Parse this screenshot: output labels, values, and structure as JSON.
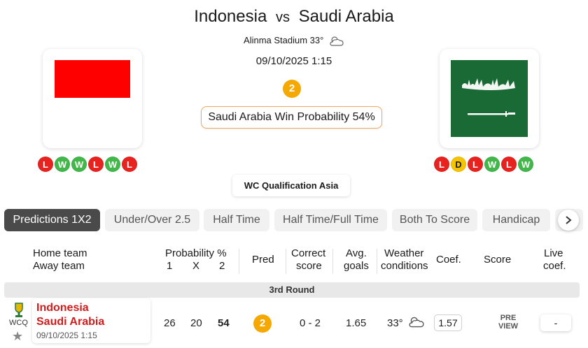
{
  "match": {
    "home": "Indonesia",
    "vs": "vs",
    "away": "Saudi Arabia",
    "venue": "Alinma Stadium 33°",
    "datetime": "09/10/2025 1:15",
    "prediction": "2",
    "win_probability": "Saudi Arabia Win Probability 54%",
    "competition": "WC Qualification Asia"
  },
  "form": {
    "home": [
      "L",
      "W",
      "W",
      "L",
      "W",
      "L"
    ],
    "away": [
      "L",
      "D",
      "L",
      "W",
      "L",
      "W"
    ]
  },
  "colors": {
    "win": "#42b84a",
    "loss": "#e8231f",
    "draw": "#f7c400",
    "prediction_badge": "#f5a800",
    "team_text": "#d01c1c"
  },
  "tabs": [
    "Predictions 1X2",
    "Under/Over 2.5",
    "Half Time",
    "Half Time/Full Time",
    "Both To Score",
    "Handicap"
  ],
  "active_tab": "Predictions 1X2",
  "table": {
    "headers": {
      "home_team": "Home team",
      "away_team": "Away team",
      "probability": "Probability %",
      "p1": "1",
      "px": "X",
      "p2": "2",
      "pred": "Pred",
      "correct1": "Correct",
      "correct2": "score",
      "avg1": "Avg.",
      "avg2": "goals",
      "weather1": "Weather",
      "weather2": "conditions",
      "coef": "Coef.",
      "score": "Score",
      "live1": "Live",
      "live2": "coef."
    },
    "round": "3rd Round",
    "row": {
      "competition_short": "WCQ",
      "home": "Indonesia",
      "away": "Saudi Arabia",
      "date": "09/10/2025 1:15",
      "prob1": "26",
      "probx": "20",
      "prob2": "54",
      "pred": "2",
      "correct_score": "0 - 2",
      "avg_goals": "1.65",
      "temperature": "33°",
      "coef": "1.57",
      "preview_line1": "PRE",
      "preview_line2": "VIEW",
      "live_coef": "-"
    }
  },
  "icons": {
    "weather": "cloudy-icon",
    "trophy": "trophy-icon",
    "favorite": "star-icon",
    "next": "chevron-right-icon"
  }
}
